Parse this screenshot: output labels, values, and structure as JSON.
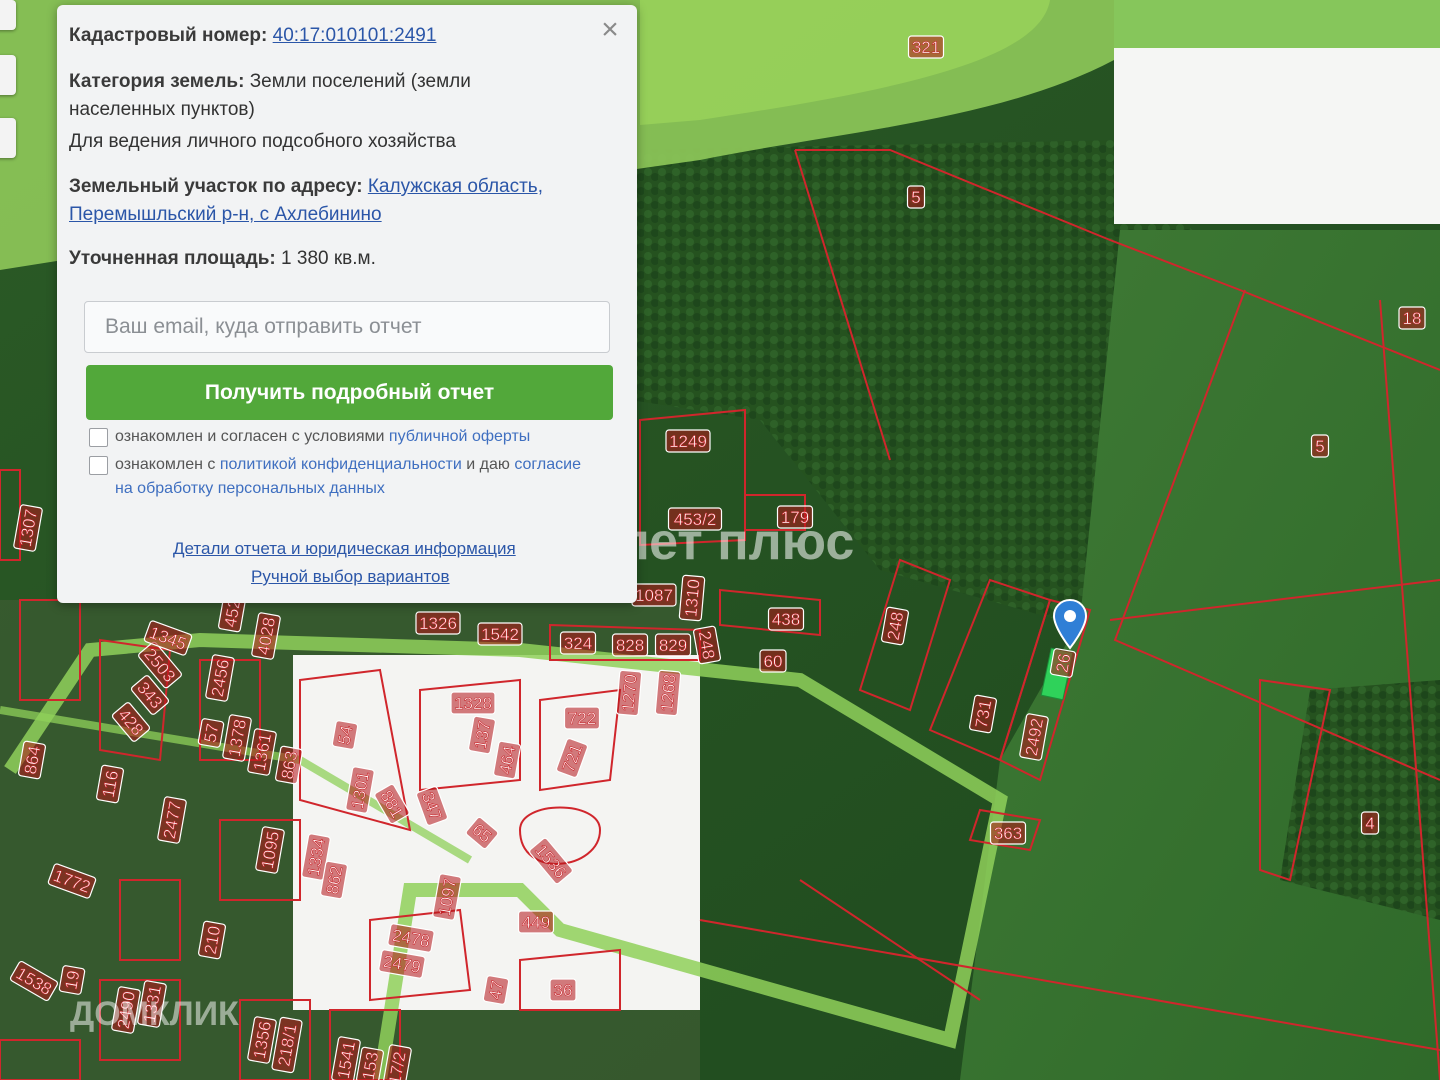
{
  "popup": {
    "cadastral_label": "Кадастровый номер:",
    "cadastral_number": "40:17:010101:2491",
    "category_label": "Категория земель:",
    "category_value": "Земли поселений (земли",
    "category_value_2": "населенных пунктов)",
    "usage": "Для ведения личного подсобного хозяйства",
    "address_label": "Земельный участок по адресу:",
    "address_part1": "Калужская область,",
    "address_part2": "Перемышльский р-н, с Ахлебинино",
    "area_label": "Уточненная площадь:",
    "area_value": "1 380 кв.м.",
    "email_placeholder": "Ваш email, куда отправить отчет",
    "submit_label": "Получить подробный отчет",
    "checkbox1_text": "ознакомлен и согласен с условиями",
    "checkbox1_link": "публичной оферты",
    "checkbox2_text": "ознакомлен с",
    "checkbox2_link": "политикой конфиденциальности",
    "checkbox2_text2": "и даю",
    "checkbox2_link2": "согласие на обработку персональных данных",
    "details_link": "Детали отчета и юридическая информация",
    "manual_link": "Ручной выбор вариантов",
    "close_icon": "close-icon"
  },
  "watermarks": {
    "samolet": "самолет плюс",
    "domclick": "ДОМКЛИК"
  },
  "map": {
    "plot_labels": [
      "321",
      "5",
      "18",
      "5",
      "4",
      "1249",
      "453/2",
      "179",
      "1087",
      "1310",
      "438",
      "248",
      "324",
      "828",
      "829",
      "248",
      "60",
      "731",
      "2492",
      "363",
      "1326",
      "1542",
      "1328",
      "722",
      "721",
      "1270",
      "1268",
      "464",
      "54",
      "1301",
      "881",
      "347",
      "65",
      "1536",
      "1334",
      "862",
      "1097",
      "2478",
      "2479",
      "36",
      "449",
      "47",
      "2503",
      "343",
      "428",
      "2456",
      "57",
      "1378",
      "1361",
      "863",
      "864",
      "116",
      "2477",
      "1095",
      "1772",
      "210",
      "1538",
      "19",
      "2490",
      "1331",
      "1356",
      "218/1",
      "1541",
      "153",
      "17/2",
      "1307",
      "452",
      "1345",
      "4028",
      "137",
      "26"
    ],
    "accent_green": "#52a83a",
    "boundary_red": "#d0262c",
    "zone_green": "#9ad35a",
    "pin_color": "#2f7fd6",
    "selected_plot_color": "#2fd25a"
  }
}
